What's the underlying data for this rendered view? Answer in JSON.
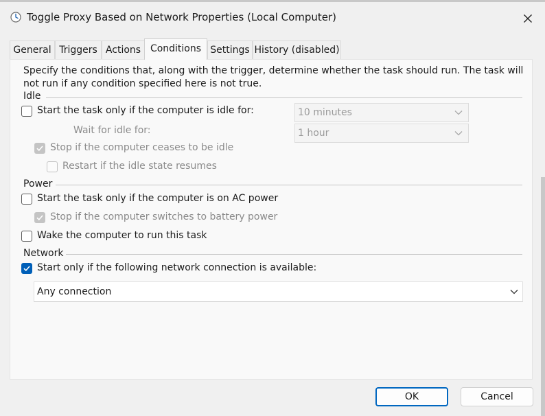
{
  "window": {
    "title": "Toggle Proxy Based on Network Properties (Local Computer)",
    "icon": "clock-icon"
  },
  "tabs": [
    {
      "label": "General",
      "active": false
    },
    {
      "label": "Triggers",
      "active": false
    },
    {
      "label": "Actions",
      "active": false
    },
    {
      "label": "Conditions",
      "active": true
    },
    {
      "label": "Settings",
      "active": false
    },
    {
      "label": "History (disabled)",
      "active": false
    }
  ],
  "conditions": {
    "description": "Specify the conditions that, along with the trigger, determine whether the task should run.  The task will not run  if any condition specified here is not true.",
    "idle": {
      "section_label": "Idle",
      "start_if_idle": {
        "label": "Start the task only if the computer is idle for:",
        "checked": false
      },
      "idle_duration": {
        "value": "10 minutes",
        "enabled": false
      },
      "wait_label": "Wait for idle for:",
      "wait_duration": {
        "value": "1 hour",
        "enabled": false
      },
      "stop_if_ceases": {
        "label": "Stop if the computer ceases to be idle",
        "checked": true,
        "enabled": false
      },
      "restart_if_resumes": {
        "label": "Restart if the idle state resumes",
        "checked": false,
        "enabled": false
      }
    },
    "power": {
      "section_label": "Power",
      "ac_power": {
        "label": "Start the task only if the computer is on AC power",
        "checked": false
      },
      "stop_on_battery": {
        "label": "Stop if the computer switches to battery power",
        "checked": true,
        "enabled": false
      },
      "wake": {
        "label": "Wake the computer to run this task",
        "checked": false
      }
    },
    "network": {
      "section_label": "Network",
      "start_only_if_network": {
        "label": "Start only if the following network connection is available:",
        "checked": true
      },
      "connection": {
        "value": "Any connection"
      }
    }
  },
  "buttons": {
    "ok": "OK",
    "cancel": "Cancel"
  },
  "colors": {
    "accent": "#005fb8",
    "panel_bg": "#f9f9f9",
    "window_bg": "#f0f0f0"
  }
}
